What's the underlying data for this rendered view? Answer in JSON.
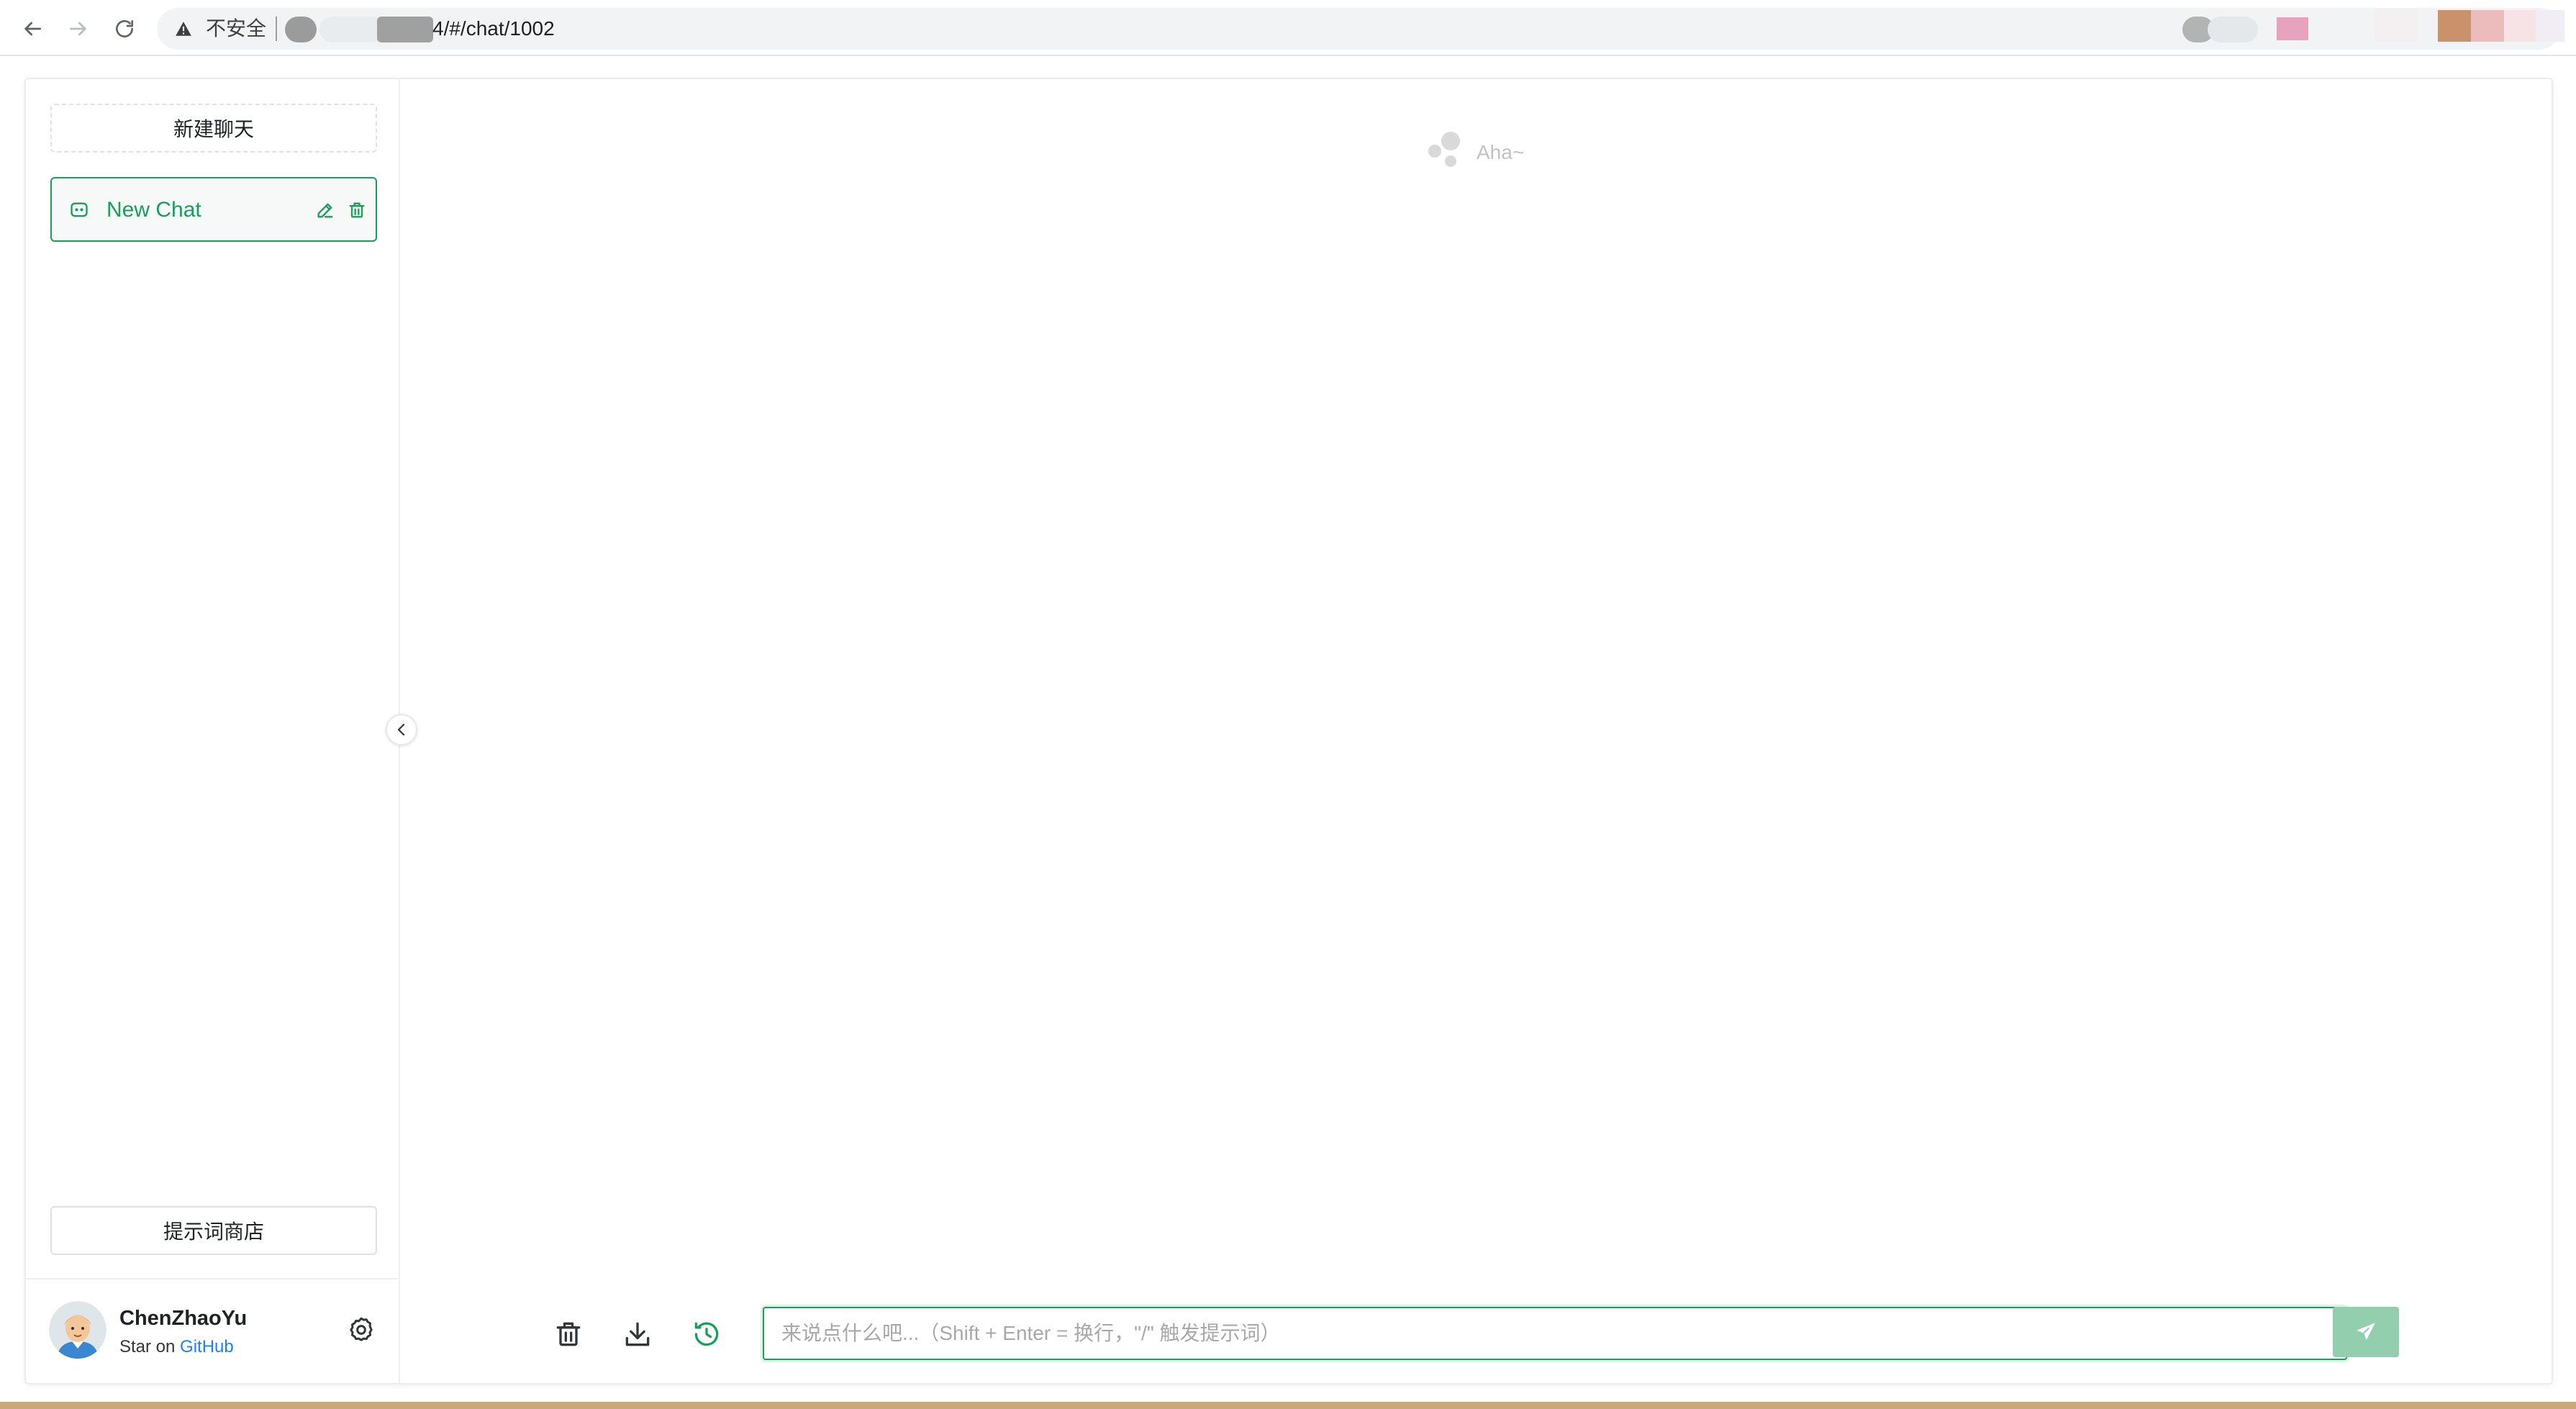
{
  "browser": {
    "security_label": "不安全",
    "url": "4/#/chat/1002"
  },
  "sidebar": {
    "new_chat_label": "新建聊天",
    "chats": [
      {
        "title": "New Chat",
        "active": true
      }
    ],
    "prompt_store_label": "提示词商店"
  },
  "user": {
    "name": "ChenZhaoYu",
    "star_prefix": "Star on ",
    "github_label": "GitHub"
  },
  "main": {
    "empty_text": "Aha~",
    "input": {
      "value": "",
      "placeholder": "来说点什么吧...（Shift + Enter = 换行，\"/\" 触发提示词）"
    }
  },
  "colors": {
    "accent": "#18a058",
    "send_button": "#93cfae",
    "link": "#2080f0"
  },
  "icons": {
    "back": "arrow-left-icon",
    "forward": "arrow-right-icon",
    "reload": "reload-icon",
    "warning": "warning-icon",
    "chat": "chat-bubble-icon",
    "edit": "edit-icon",
    "delete": "trash-icon",
    "settings": "gear-icon",
    "collapse": "chevron-left-icon",
    "clear": "trash-icon",
    "download": "download-icon",
    "context": "history-icon",
    "send": "send-icon"
  }
}
